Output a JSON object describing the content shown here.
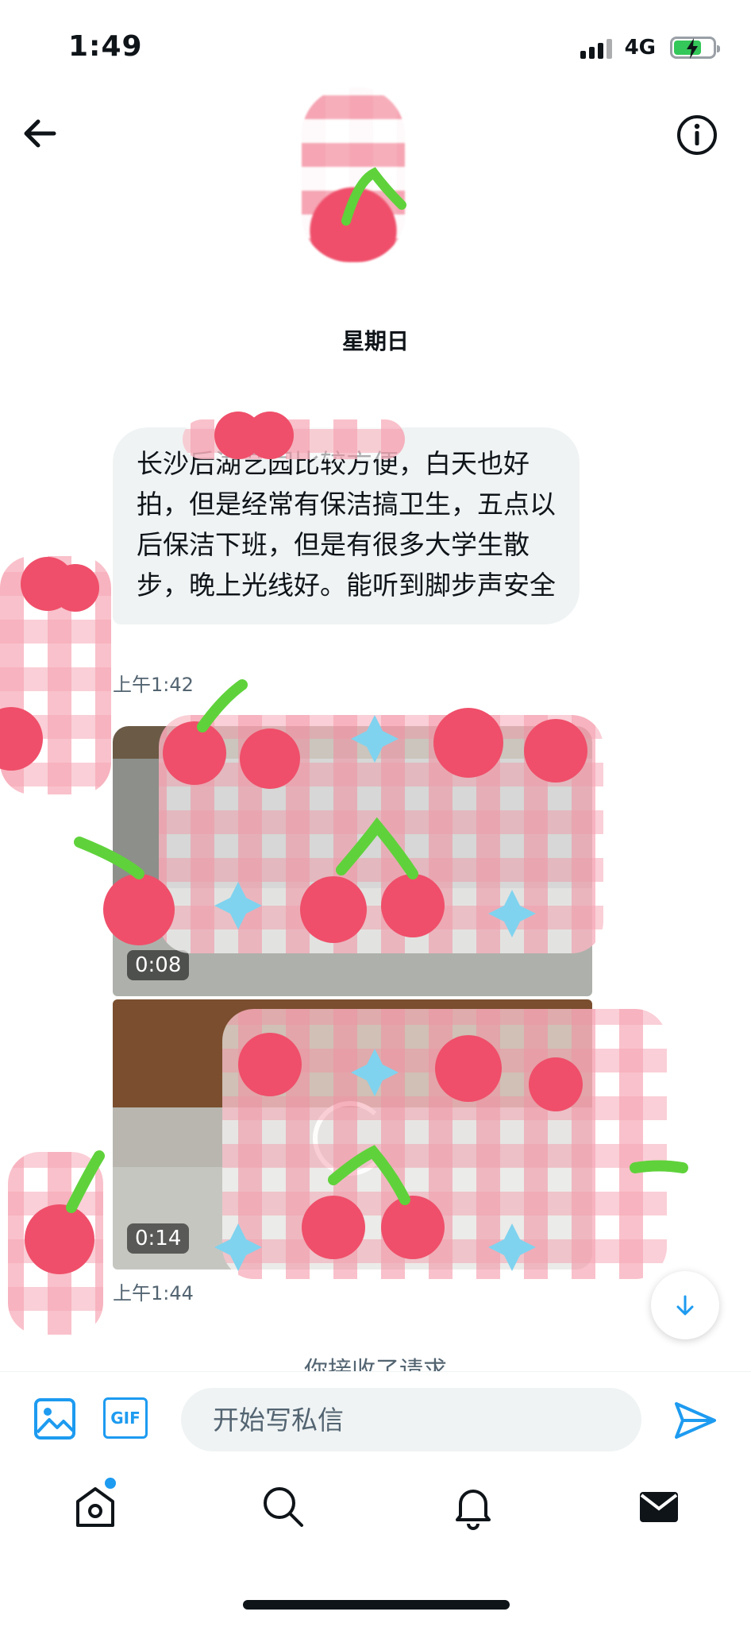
{
  "status_bar": {
    "time": "1:49",
    "network": "4G"
  },
  "header": {
    "back_icon": "arrow-left-icon",
    "info_icon": "info-circle-icon"
  },
  "conversation": {
    "date_separator": "星期日",
    "messages": [
      {
        "type": "text",
        "text": "长沙后湖艺园比较方便，白天也好拍，但是经常有保洁搞卫生，五点以后保洁下班，但是有很多大学生散步，晚上光线好。能听到脚步声安全",
        "time": "上午1:42"
      },
      {
        "type": "video",
        "duration": "0:08"
      },
      {
        "type": "video",
        "duration": "0:14",
        "loading": true,
        "time": "上午1:44"
      }
    ],
    "partial_text": "你接收了请求"
  },
  "composer": {
    "placeholder": "开始写私信",
    "image_icon": "image-icon",
    "gif_label": "GIF",
    "send_icon": "send-icon"
  },
  "tabs": [
    {
      "name": "home",
      "icon": "home-icon",
      "has_dot": true
    },
    {
      "name": "search",
      "icon": "search-icon"
    },
    {
      "name": "notifications",
      "icon": "bell-icon"
    },
    {
      "name": "messages",
      "icon": "mail-icon",
      "active": true
    }
  ],
  "colors": {
    "accent": "#1d9bf0",
    "bubble_bg": "#eff3f4",
    "text": "#0f1419",
    "muted": "#536471",
    "sticker_pink": "#ef4f6a",
    "sticker_green": "#5fd23b"
  }
}
